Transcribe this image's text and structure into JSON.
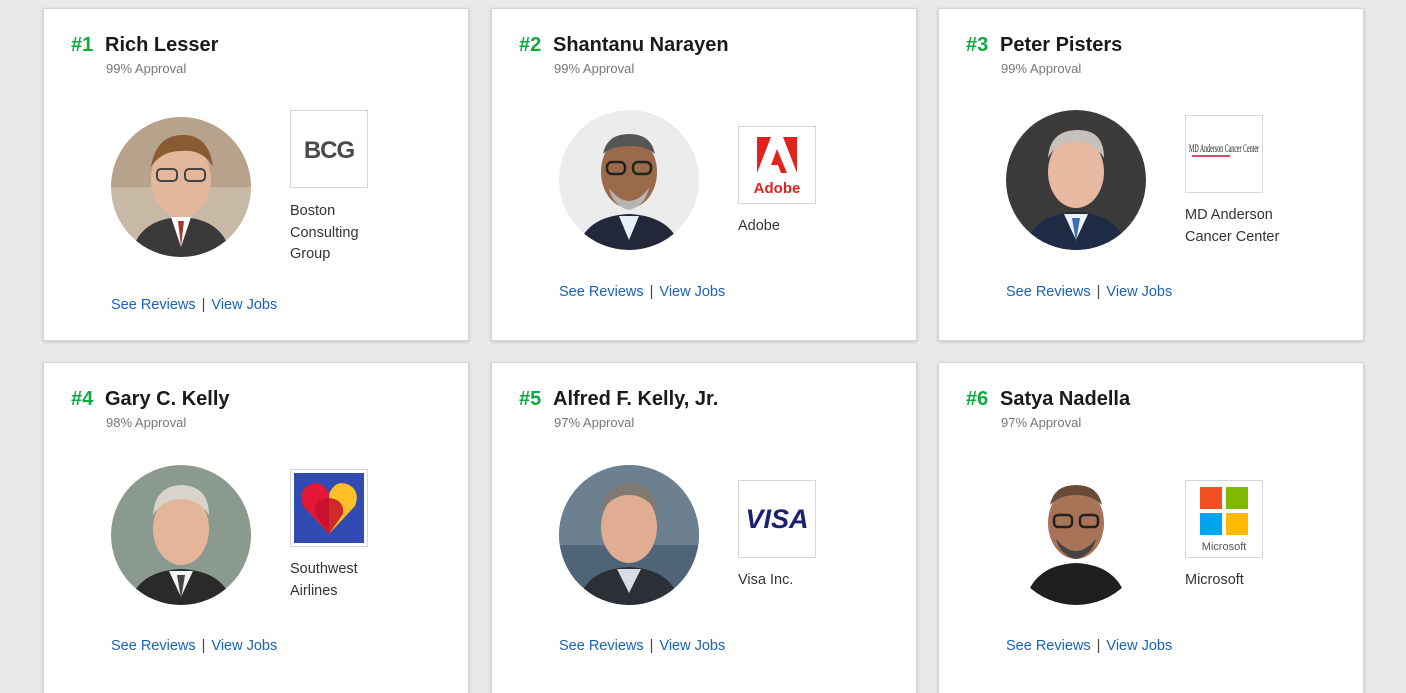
{
  "cards": [
    {
      "rank": "#1",
      "name": "Rich Lesser",
      "approval": "99% Approval",
      "company": "Boston Consulting Group",
      "see_reviews": "See Reviews",
      "separator": "|",
      "view_jobs": "View Jobs",
      "logo_icon": "bcg-logo",
      "logo_text": "BCG"
    },
    {
      "rank": "#2",
      "name": "Shantanu Narayen",
      "approval": "99% Approval",
      "company": "Adobe",
      "see_reviews": "See Reviews",
      "separator": "|",
      "view_jobs": "View Jobs",
      "logo_icon": "adobe-logo",
      "logo_text": "Adobe"
    },
    {
      "rank": "#3",
      "name": "Peter Pisters",
      "approval": "99% Approval",
      "company": "MD Anderson Cancer Center",
      "see_reviews": "See Reviews",
      "separator": "|",
      "view_jobs": "View Jobs",
      "logo_icon": "md-anderson-logo",
      "logo_text": "MD Anderson Cancer Center"
    },
    {
      "rank": "#4",
      "name": "Gary C. Kelly",
      "approval": "98% Approval",
      "company": "Southwest Airlines",
      "see_reviews": "See Reviews",
      "separator": "|",
      "view_jobs": "View Jobs",
      "logo_icon": "southwest-heart-logo",
      "logo_text": ""
    },
    {
      "rank": "#5",
      "name": "Alfred F. Kelly, Jr.",
      "approval": "97% Approval",
      "company": "Visa Inc.",
      "see_reviews": "See Reviews",
      "separator": "|",
      "view_jobs": "View Jobs",
      "logo_icon": "visa-logo",
      "logo_text": "VISA"
    },
    {
      "rank": "#6",
      "name": "Satya Nadella",
      "approval": "97% Approval",
      "company": "Microsoft",
      "see_reviews": "See Reviews",
      "separator": "|",
      "view_jobs": "View Jobs",
      "logo_icon": "microsoft-logo",
      "logo_text": "Microsoft"
    }
  ],
  "colors": {
    "rank": "#0caa41",
    "link": "#1861bf",
    "page_background": "#e9e9e9"
  }
}
